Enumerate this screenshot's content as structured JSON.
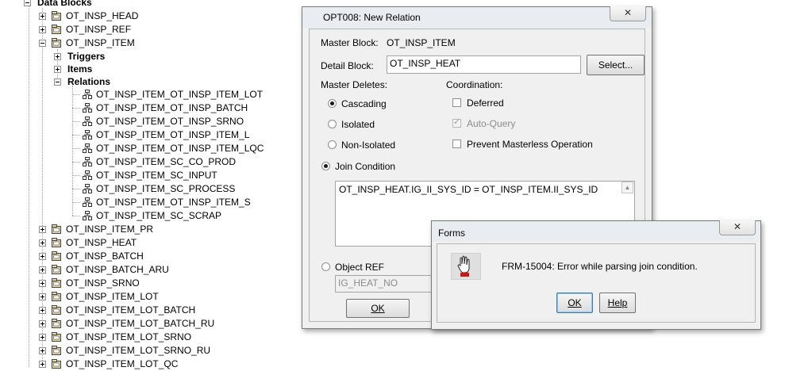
{
  "tree": {
    "root_label": "Data Blocks",
    "top_items": [
      "OT_INSP_HEAD",
      "OT_INSP_REF",
      "OT_INSP_ITEM"
    ],
    "item_children": [
      "Triggers",
      "Items",
      "Relations"
    ],
    "relations": [
      "OT_INSP_ITEM_OT_INSP_ITEM_LOT",
      "OT_INSP_ITEM_OT_INSP_BATCH",
      "OT_INSP_ITEM_OT_INSP_SRNO",
      "OT_INSP_ITEM_OT_INSP_ITEM_L",
      "OT_INSP_ITEM_OT_INSP_ITEM_LQC",
      "OT_INSP_ITEM_SC_CO_PROD",
      "OT_INSP_ITEM_SC_INPUT",
      "OT_INSP_ITEM_SC_PROCESS",
      "OT_INSP_ITEM_OT_INSP_ITEM_S",
      "OT_INSP_ITEM_SC_SCRAP"
    ],
    "more_items": [
      "OT_INSP_ITEM_PR",
      "OT_INSP_HEAT",
      "OT_INSP_BATCH",
      "OT_INSP_BATCH_ARU",
      "OT_INSP_SRNO",
      "OT_INSP_ITEM_LOT",
      "OT_INSP_ITEM_LOT_BATCH",
      "OT_INSP_ITEM_LOT_BATCH_RU",
      "OT_INSP_ITEM_LOT_SRNO",
      "OT_INSP_ITEM_LOT_SRNO_RU",
      "OT_INSP_ITEM_LOT_QC"
    ]
  },
  "relation_dialog": {
    "title": "OPT008: New Relation",
    "close": "✕",
    "master_block_label": "Master Block:",
    "master_block_value": "OT_INSP_ITEM",
    "detail_block_label": "Detail Block:",
    "detail_block_value": "OT_INSP_HEAT",
    "select_button": "Select...",
    "master_deletes_label": "Master Deletes:",
    "opt_cascading": "Cascading",
    "opt_isolated": "Isolated",
    "opt_non_isolated": "Non-Isolated",
    "coordination_label": "Coordination:",
    "deferred": "Deferred",
    "auto_query": "Auto-Query",
    "prevent_masterless": "Prevent Masterless Operation",
    "join_condition_label": "Join Condition",
    "join_condition_value": "OT_INSP_HEAT.IG_II_SYS_ID = OT_INSP_ITEM.II_SYS_ID",
    "object_ref_label": "Object REF",
    "object_ref_value": "IG_HEAT_NO",
    "ok_button": "OK"
  },
  "error_dialog": {
    "title": "Forms",
    "close": "✕",
    "message": "FRM-15004: Error while parsing join condition.",
    "ok_button": "OK",
    "help_button": "Help"
  }
}
